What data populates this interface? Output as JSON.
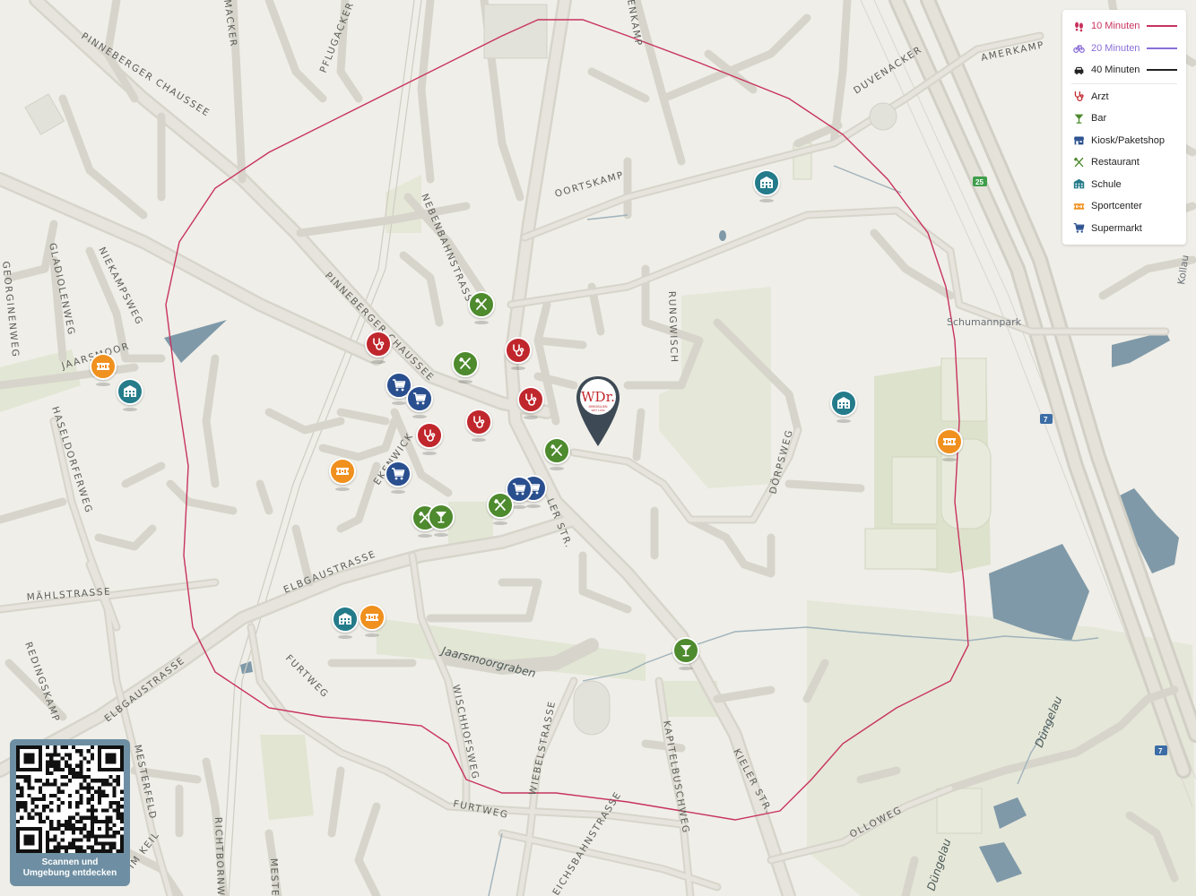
{
  "legend": {
    "isochrones": [
      {
        "label": "10 Minuten",
        "color": "#c8335e",
        "icon": "walk-icon"
      },
      {
        "label": "20 Minuten",
        "color": "#8a6fd8",
        "icon": "bike-icon"
      },
      {
        "label": "40 Minuten",
        "color": "#222222",
        "icon": "car-icon"
      }
    ],
    "categories": [
      {
        "label": "Arzt",
        "color": "#c0272d",
        "icon": "stethoscope-icon"
      },
      {
        "label": "Bar",
        "color": "#4e8a2e",
        "icon": "cocktail-icon"
      },
      {
        "label": "Kiosk/Paketshop",
        "color": "#2a4f8f",
        "icon": "kiosk-icon"
      },
      {
        "label": "Restaurant",
        "color": "#4e8a2e",
        "icon": "cutlery-icon"
      },
      {
        "label": "Schule",
        "color": "#247b8a",
        "icon": "school-icon"
      },
      {
        "label": "Sportcenter",
        "color": "#f0901e",
        "icon": "ticket-icon"
      },
      {
        "label": "Supermarkt",
        "color": "#2a4f8f",
        "icon": "cart-icon"
      }
    ]
  },
  "qr": {
    "caption_line1": "Scannen und",
    "caption_line2": "Umgebung entdecken"
  },
  "home": {
    "logo_text": "WDr.",
    "logo_sub1": "IMMOBILIEN",
    "logo_sub2": "SEIT 1930"
  },
  "streets": {
    "pinneberger1": "Pinneberger Chaussee",
    "pinneberger2": "Pinneberger Chaussee",
    "pflugacker": "Pflugacker",
    "macker": "Macker",
    "ohlenkamp": "Enkamp",
    "duvenacker": "Duvenacker",
    "amerkamp": "Amerkamp",
    "oortskamp": "Oortskamp",
    "nebenbahn": "Nebenbahnstrass",
    "rungwisch": "Rungwisch",
    "doerpsweg": "Dörpsweg",
    "kieler1": "Ler Str.",
    "kieler2": "Kieler Str.",
    "elbgau1": "Elbgaustrasse",
    "elbgau2": "Elbgaustrasse",
    "jaarsmoor": "Jaarsmoor",
    "gladiolen": "Gladiolenweg",
    "niekamp": "Niekampsweg",
    "georginen": "Georginenweg",
    "haseldorfer": "Haseldorferweg",
    "maehl": "Mählstrasse",
    "reding": "Redingskamp",
    "furtweg1": "Furtweg",
    "furtweg2": "Furtweg",
    "wischhof": "Wischhofsweg",
    "wiebel": "Wiebelstrasse",
    "kapitel": "Kapitelbuschweg",
    "olloweg": "Olloweg",
    "eichsbahn": "Eichsbahnstrasse",
    "ekenwick": "Ekenwick",
    "mesterfeld": "Mesterfeld",
    "imkeil": "Im Keil",
    "richtborn": "Richtbornwe",
    "meste": "Meste",
    "schumann": "Schumannpark",
    "kollau": "Kollau",
    "jaarsmoorgraben": "Jaarsmoorgraben",
    "duengelau1": "Düngelau",
    "duengelau2": "Düngelau",
    "route25": "25",
    "route7a": "7",
    "route7b": "7"
  },
  "markers": [
    {
      "type": "Restaurant",
      "icon": "cutlery-icon",
      "color": "#4e8a2e"
    },
    {
      "type": "Arzt",
      "icon": "stethoscope-icon",
      "color": "#c0272d"
    },
    {
      "type": "Restaurant",
      "icon": "cutlery-icon",
      "color": "#4e8a2e"
    },
    {
      "type": "Arzt",
      "icon": "stethoscope-icon",
      "color": "#c0272d"
    },
    {
      "type": "Supermarkt",
      "icon": "cart-icon",
      "color": "#2a4f8f"
    },
    {
      "type": "Supermarkt",
      "icon": "cart-icon",
      "color": "#2a4f8f"
    },
    {
      "type": "Arzt",
      "icon": "stethoscope-icon",
      "color": "#c0272d"
    },
    {
      "type": "Arzt",
      "icon": "stethoscope-icon",
      "color": "#c0272d"
    },
    {
      "type": "Arzt",
      "icon": "stethoscope-icon",
      "color": "#c0272d"
    },
    {
      "type": "Restaurant",
      "icon": "cutlery-icon",
      "color": "#4e8a2e"
    },
    {
      "type": "Supermarkt",
      "icon": "cart-icon",
      "color": "#2a4f8f"
    },
    {
      "type": "Supermarkt",
      "icon": "cart-icon",
      "color": "#2a4f8f"
    },
    {
      "type": "Supermarkt",
      "icon": "cart-icon",
      "color": "#2a4f8f"
    },
    {
      "type": "Restaurant",
      "icon": "cutlery-icon",
      "color": "#4e8a2e"
    },
    {
      "type": "Restaurant",
      "icon": "cutlery-icon",
      "color": "#4e8a2e"
    },
    {
      "type": "Bar",
      "icon": "cocktail-icon",
      "color": "#4e8a2e"
    },
    {
      "type": "Sportcenter",
      "icon": "ticket-icon",
      "color": "#f0901e"
    },
    {
      "type": "Sportcenter",
      "icon": "ticket-icon",
      "color": "#f0901e"
    },
    {
      "type": "Schule",
      "icon": "school-icon",
      "color": "#247b8a"
    },
    {
      "type": "Schule",
      "icon": "school-icon",
      "color": "#247b8a"
    },
    {
      "type": "Sportcenter",
      "icon": "ticket-icon",
      "color": "#f0901e"
    },
    {
      "type": "Schule",
      "icon": "school-icon",
      "color": "#247b8a"
    },
    {
      "type": "Schule",
      "icon": "school-icon",
      "color": "#247b8a"
    },
    {
      "type": "Sportcenter",
      "icon": "ticket-icon",
      "color": "#f0901e"
    },
    {
      "type": "Bar",
      "icon": "cocktail-icon",
      "color": "#4e8a2e"
    }
  ]
}
